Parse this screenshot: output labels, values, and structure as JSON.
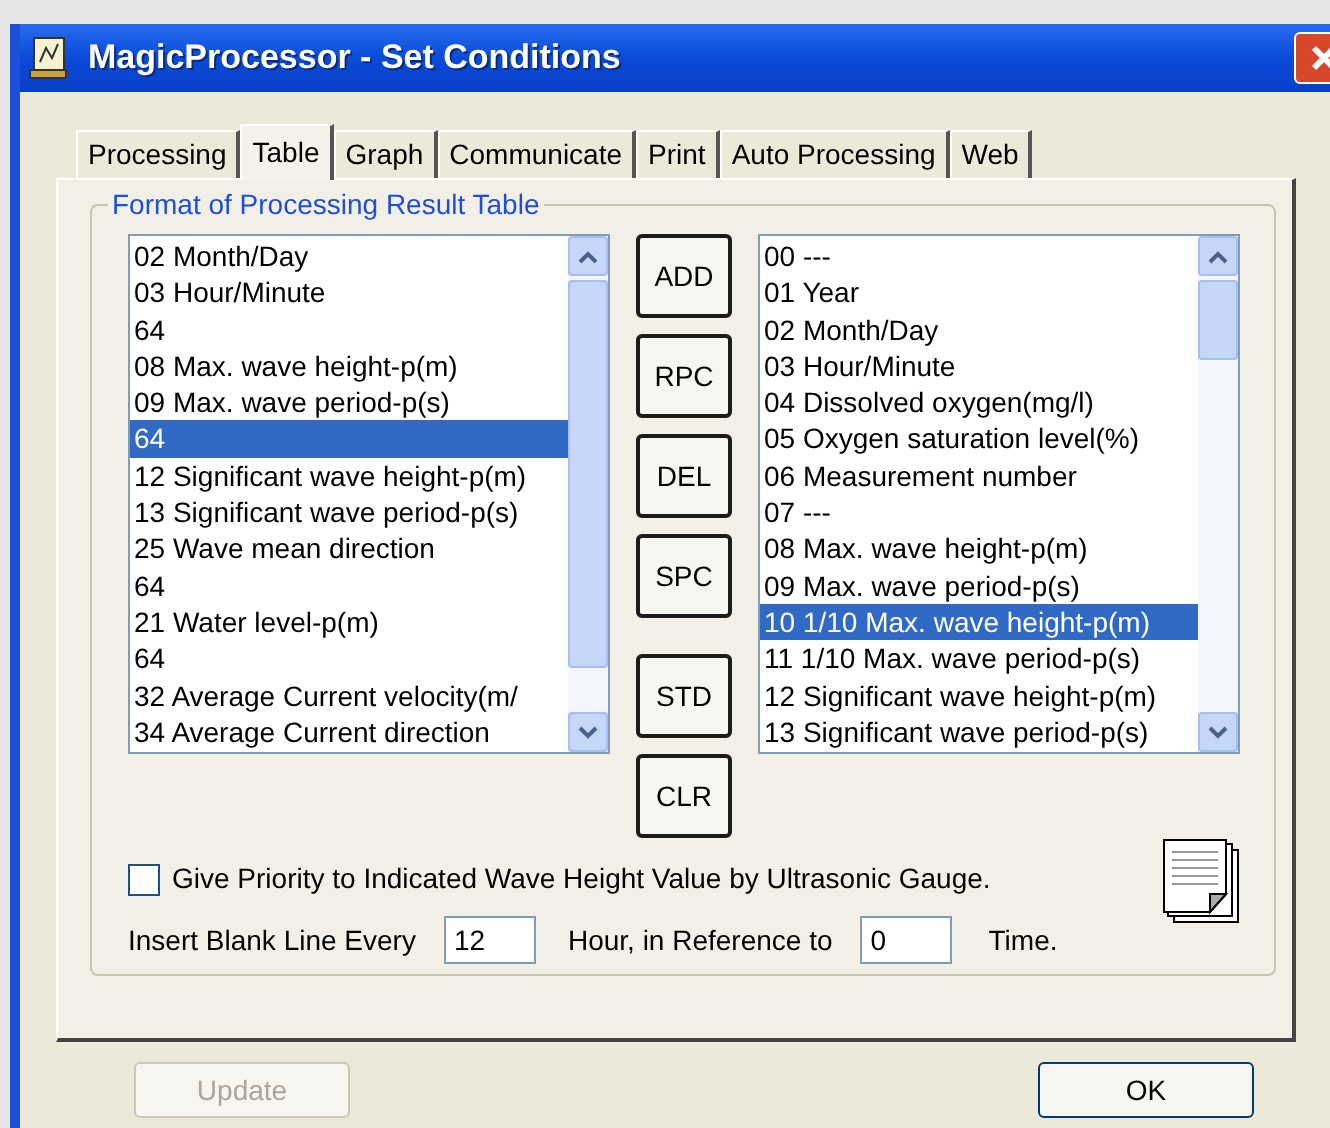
{
  "window": {
    "title": "MagicProcessor - Set Conditions"
  },
  "tabs": [
    {
      "label": "Processing",
      "selected": false
    },
    {
      "label": "Table",
      "selected": true
    },
    {
      "label": "Graph",
      "selected": false
    },
    {
      "label": "Communicate",
      "selected": false
    },
    {
      "label": "Print",
      "selected": false
    },
    {
      "label": "Auto Processing",
      "selected": false
    },
    {
      "label": "Web",
      "selected": false
    }
  ],
  "group": {
    "title": "Format of Processing Result Table"
  },
  "left_list": [
    {
      "label": "02 Month/Day",
      "selected": false
    },
    {
      "label": "03 Hour/Minute",
      "selected": false
    },
    {
      "label": "64",
      "selected": false
    },
    {
      "label": "08 Max. wave height-p(m)",
      "selected": false
    },
    {
      "label": "09 Max. wave period-p(s)",
      "selected": false
    },
    {
      "label": "64",
      "selected": true
    },
    {
      "label": "12 Significant wave height-p(m)",
      "selected": false
    },
    {
      "label": "13 Significant wave period-p(s)",
      "selected": false
    },
    {
      "label": "25 Wave mean direction",
      "selected": false
    },
    {
      "label": "64",
      "selected": false
    },
    {
      "label": "21 Water level-p(m)",
      "selected": false
    },
    {
      "label": "64",
      "selected": false
    },
    {
      "label": "32 Average Current velocity(m/",
      "selected": false
    },
    {
      "label": "34 Average Current direction",
      "selected": false
    }
  ],
  "action_buttons": [
    "ADD",
    "RPC",
    "DEL",
    "SPC",
    "STD",
    "CLR"
  ],
  "right_list": [
    {
      "label": "00 ---",
      "selected": false
    },
    {
      "label": "01 Year",
      "selected": false
    },
    {
      "label": "02 Month/Day",
      "selected": false
    },
    {
      "label": "03 Hour/Minute",
      "selected": false
    },
    {
      "label": "04 Dissolved oxygen(mg/l)",
      "selected": false
    },
    {
      "label": "05 Oxygen saturation level(%)",
      "selected": false
    },
    {
      "label": "06 Measurement number",
      "selected": false
    },
    {
      "label": "07 ---",
      "selected": false
    },
    {
      "label": "08 Max. wave height-p(m)",
      "selected": false
    },
    {
      "label": "09 Max. wave period-p(s)",
      "selected": false
    },
    {
      "label": "10 1/10 Max. wave height-p(m)",
      "selected": true
    },
    {
      "label": "11 1/10 Max. wave period-p(s)",
      "selected": false
    },
    {
      "label": "12 Significant wave height-p(m)",
      "selected": false
    },
    {
      "label": "13 Significant wave period-p(s)",
      "selected": false
    }
  ],
  "priority_checkbox": {
    "label": "Give Priority to Indicated Wave Height Value by Ultrasonic Gauge.",
    "checked": false
  },
  "blank_line": {
    "label_before": "Insert Blank Line Every",
    "hours": "12",
    "label_middle": "Hour, in Reference to",
    "reference": "0",
    "label_after": "Time."
  },
  "footer": {
    "update_button": {
      "label": "Update",
      "disabled": true
    },
    "ok_button": {
      "label": "OK",
      "disabled": false
    }
  }
}
